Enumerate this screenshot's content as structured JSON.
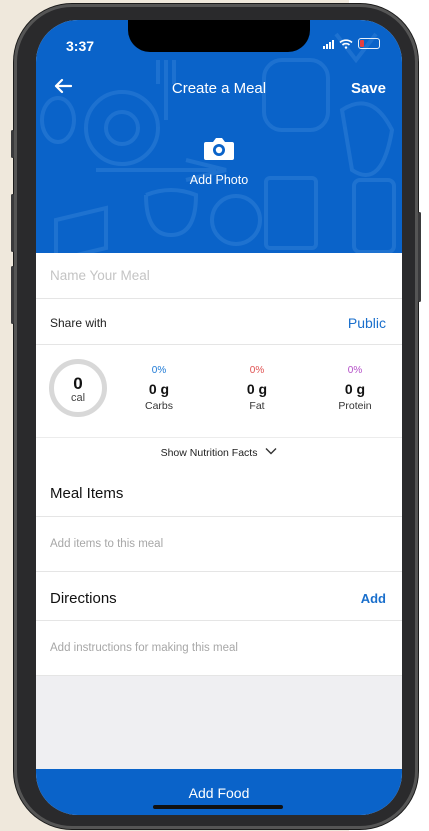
{
  "status_bar": {
    "time": "3:37"
  },
  "nav": {
    "back_icon": "arrow-left-icon",
    "title": "Create a Meal",
    "save_label": "Save"
  },
  "photo": {
    "icon": "camera-icon",
    "label": "Add Photo"
  },
  "meal_name": {
    "placeholder": "Name Your Meal",
    "value": ""
  },
  "share": {
    "label": "Share with",
    "value": "Public"
  },
  "summary": {
    "calories": {
      "value": "0",
      "unit": "cal"
    },
    "macros": [
      {
        "percent": "0%",
        "grams": "0 g",
        "name": "Carbs",
        "color": "#1f7ad6"
      },
      {
        "percent": "0%",
        "grams": "0 g",
        "name": "Fat",
        "color": "#e05252"
      },
      {
        "percent": "0%",
        "grams": "0 g",
        "name": "Protein",
        "color": "#b44fc8"
      }
    ]
  },
  "nutrition_toggle": {
    "label": "Show Nutrition Facts",
    "icon": "chevron-down-icon"
  },
  "meal_items": {
    "title": "Meal Items",
    "hint": "Add items to this meal"
  },
  "directions": {
    "title": "Directions",
    "add_label": "Add",
    "hint": "Add instructions for making this meal"
  },
  "footer": {
    "add_food_label": "Add Food"
  },
  "colors": {
    "brand_blue": "#0a63c9",
    "link_blue": "#1a6fcc"
  }
}
